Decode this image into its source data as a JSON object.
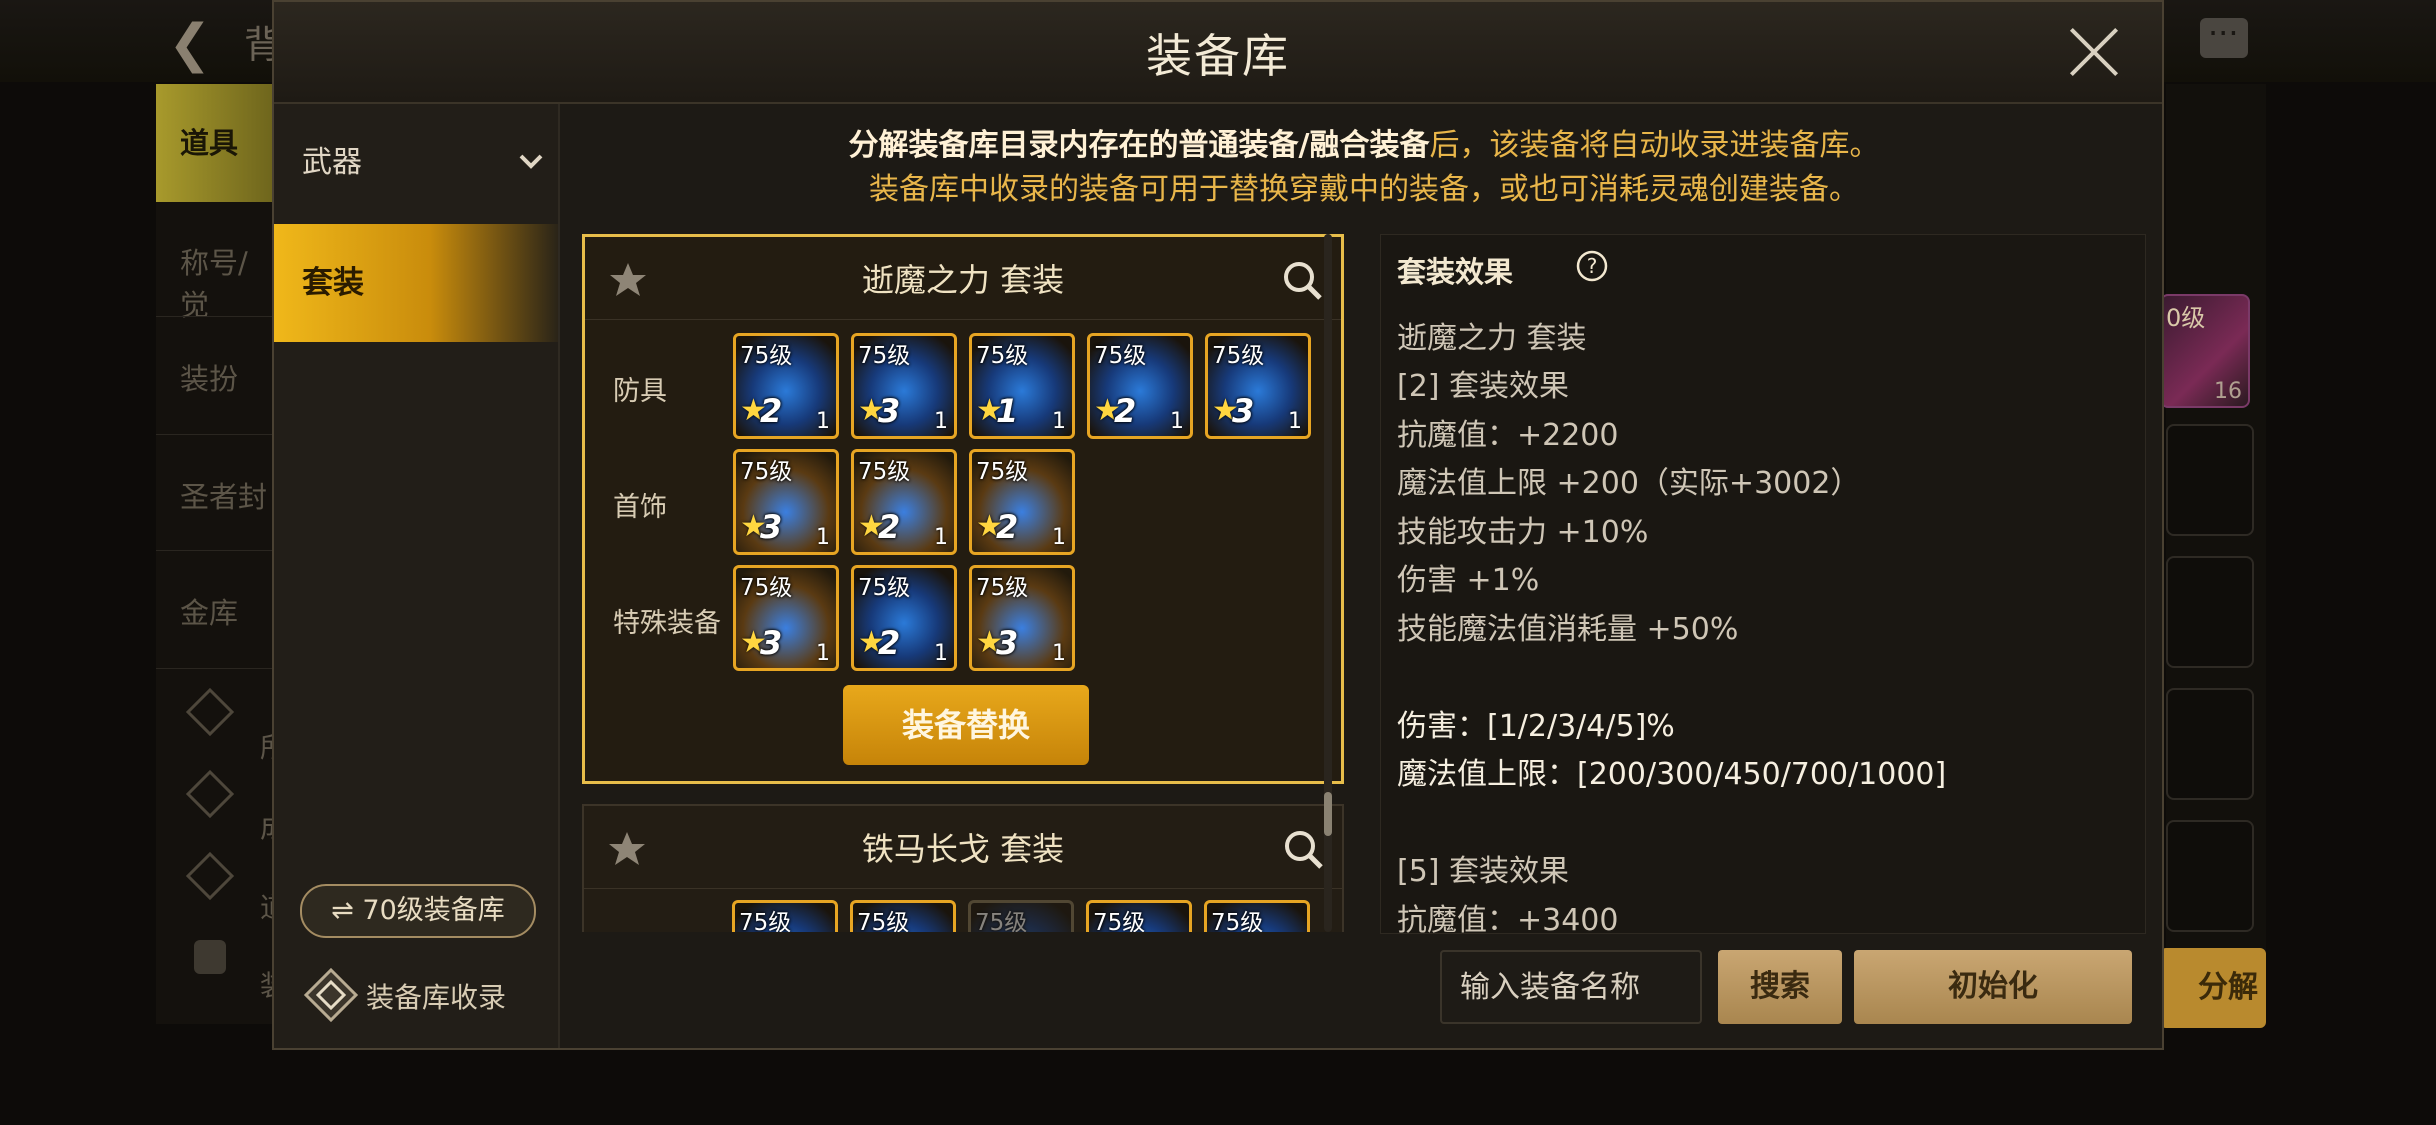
{
  "background": {
    "title_partial": "背",
    "left_tabs": [
      "道具",
      "称号/觉",
      "装扮",
      "圣者封",
      "金库"
    ],
    "left_sub": [
      "所",
      "成",
      "道",
      "装"
    ],
    "thumb_level": "0级",
    "thumb_count": "16",
    "fenjie_label": "分解"
  },
  "modal": {
    "title": "装备库",
    "sidebar": {
      "weapon_label": "武器",
      "set_label": "套装",
      "level_button": "⇌ 70级装备库",
      "collect_label": "装备库收录"
    },
    "notice": {
      "line1_a": "分解装备库目录内存在的普通装备/融合装备",
      "line1_b": "后，该装备将自动收录进装备库。",
      "line2": "装备库中收录的装备可用于替换穿戴中的装备，或也可消耗灵魂创建装备。"
    },
    "sets": [
      {
        "title": "逝魔之力  套装",
        "rows": [
          {
            "label": "防具",
            "items": [
              {
                "level": "75级",
                "grade": "2",
                "count": "1"
              },
              {
                "level": "75级",
                "grade": "3",
                "count": "1"
              },
              {
                "level": "75级",
                "grade": "1",
                "count": "1"
              },
              {
                "level": "75级",
                "grade": "2",
                "count": "1"
              },
              {
                "level": "75级",
                "grade": "3",
                "count": "1"
              }
            ]
          },
          {
            "label": "首饰",
            "items": [
              {
                "level": "75级",
                "grade": "3",
                "count": "1"
              },
              {
                "level": "75级",
                "grade": "2",
                "count": "1"
              },
              {
                "level": "75级",
                "grade": "2",
                "count": "1"
              }
            ]
          },
          {
            "label": "特殊装备",
            "items": [
              {
                "level": "75级",
                "grade": "3",
                "count": "1"
              },
              {
                "level": "75级",
                "grade": "2",
                "count": "1"
              },
              {
                "level": "75级",
                "grade": "3",
                "count": "1"
              }
            ]
          }
        ],
        "swap_label": "装备替换"
      },
      {
        "title": "铁马长戈  套装",
        "items_level": [
          "75级",
          "75级",
          "75级",
          "75级",
          "75级"
        ]
      }
    ],
    "effect": {
      "heading": "套装效果",
      "lines": [
        "逝魔之力  套装",
        "[2] 套装效果",
        "抗魔值：+2200",
        "魔法值上限 +200（实际+3002）",
        "技能攻击力 +10%",
        "伤害 +1%",
        "技能魔法值消耗量 +50%",
        "",
        "伤害：[1/2/3/4/5]%",
        "魔法值上限：[200/300/450/700/1000]",
        "",
        "[5] 套装效果",
        "抗魔值：+3400"
      ]
    },
    "search": {
      "placeholder": "输入装备名称",
      "search_label": "搜索",
      "reset_label": "初始化"
    }
  }
}
